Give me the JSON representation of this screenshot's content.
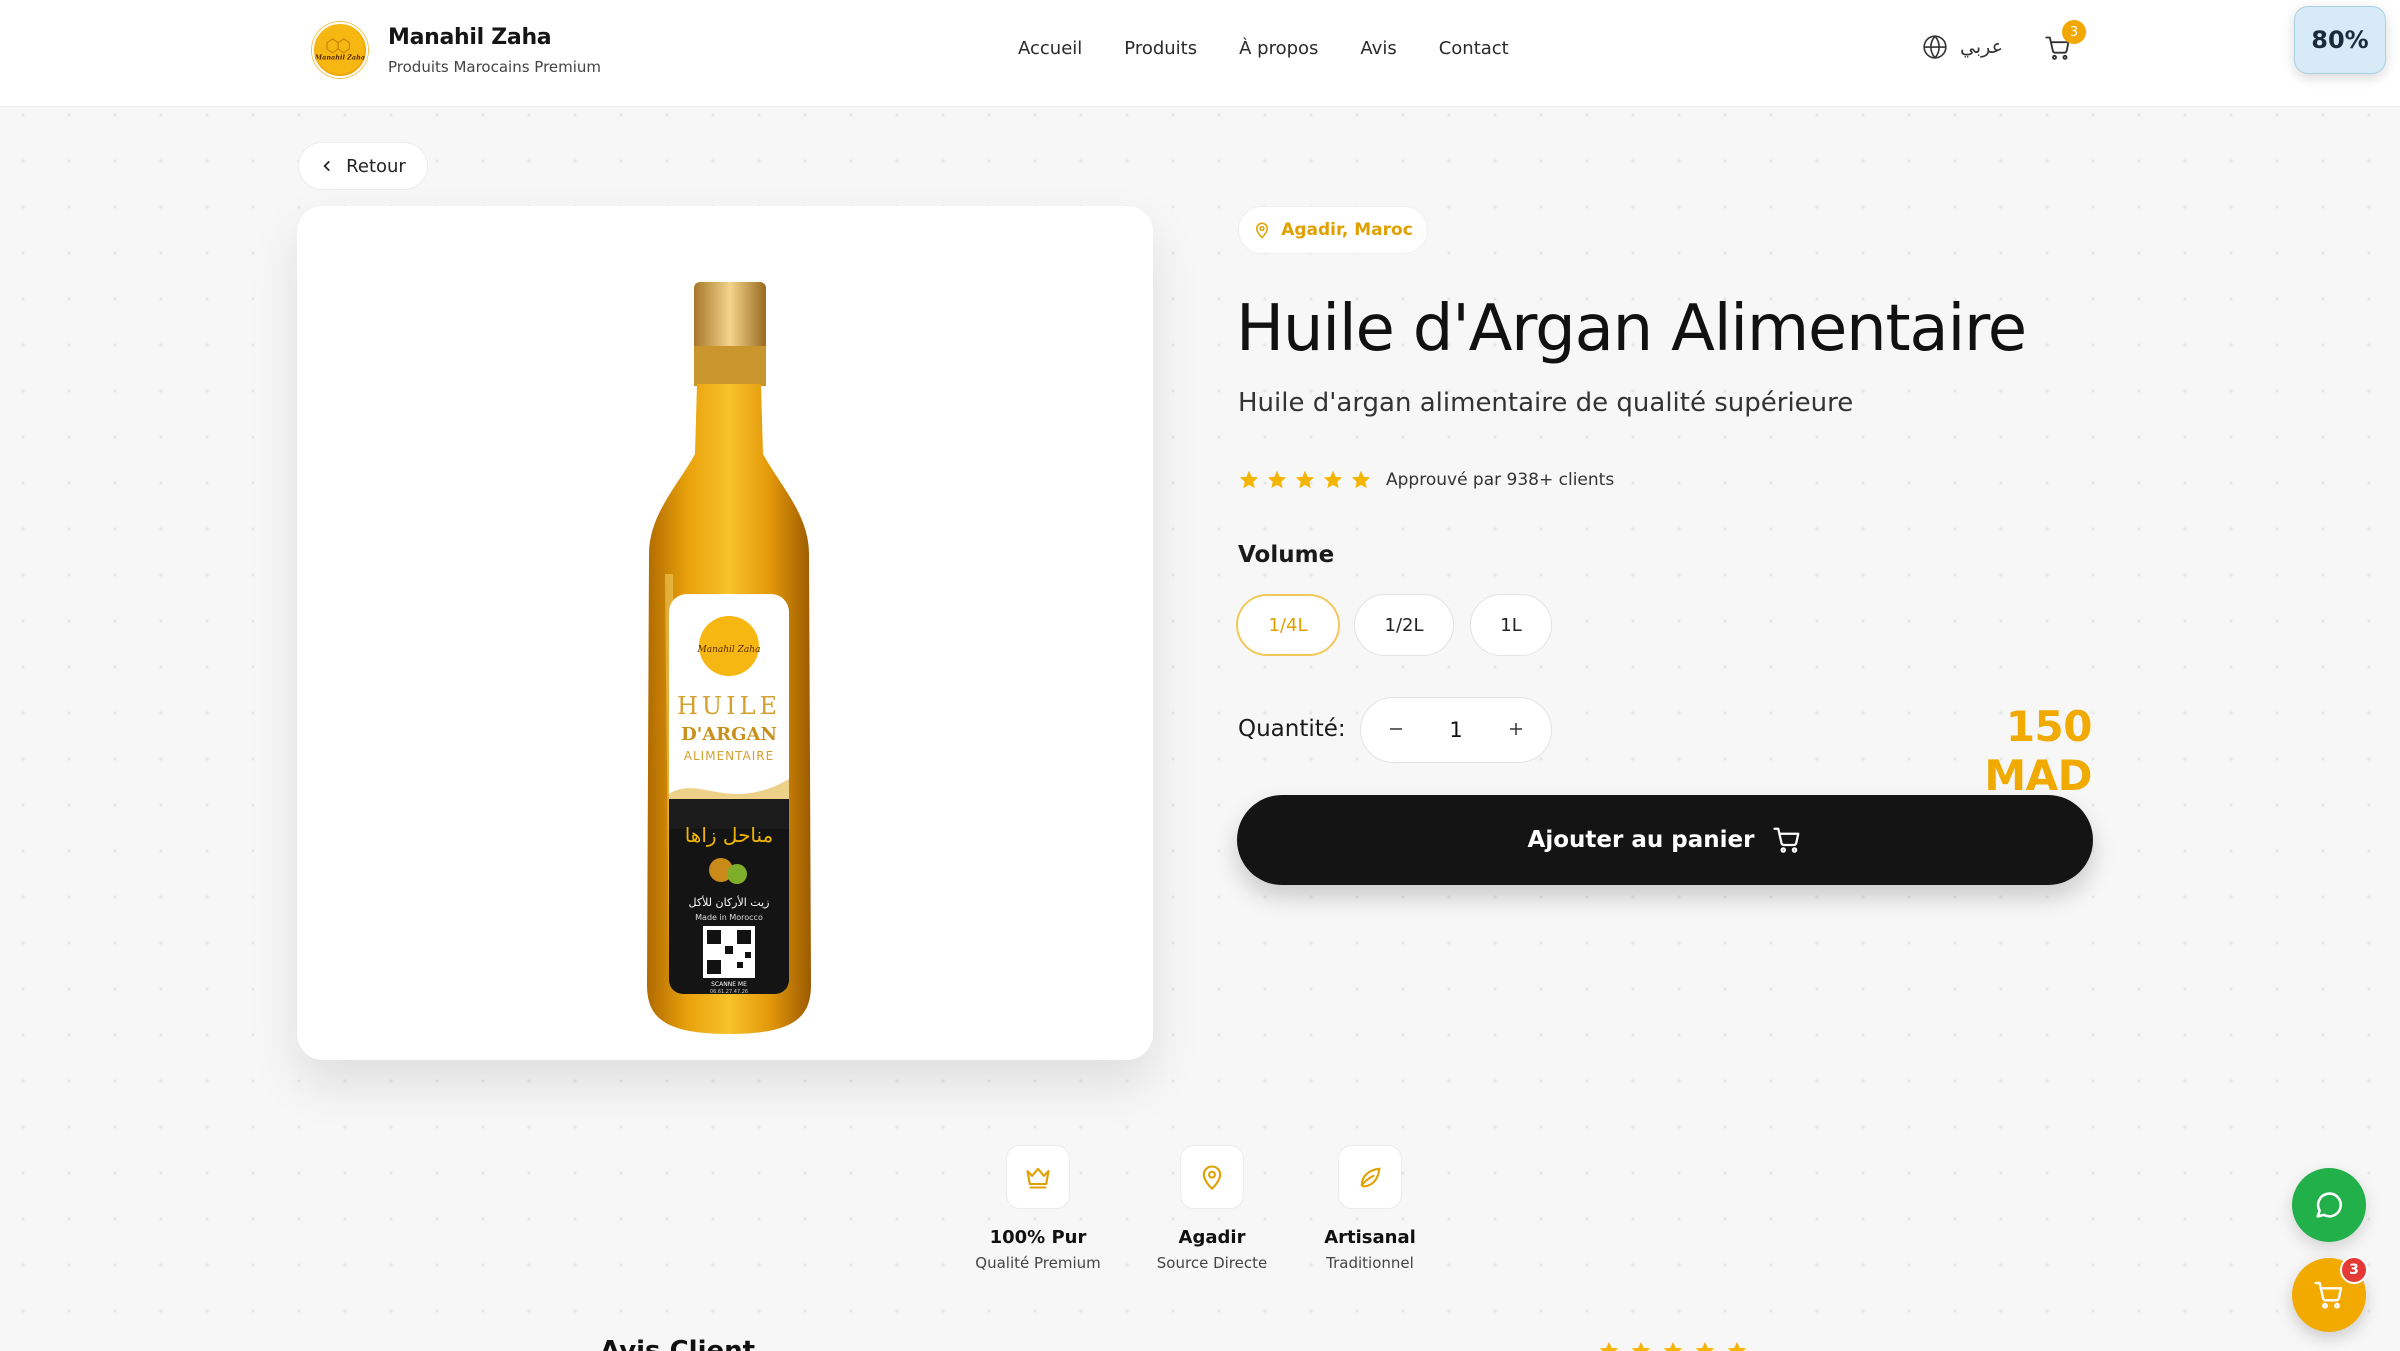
{
  "header": {
    "brand_name": "Manahil Zaha",
    "brand_subtitle": "Produits Marocains Premium",
    "logo_text": "Manahil Zaha",
    "nav": [
      "Accueil",
      "Produits",
      "À propos",
      "Avis",
      "Contact"
    ],
    "language_label": "عربي",
    "cart_count": "3"
  },
  "browser": {
    "zoom": "80%"
  },
  "back_label": "Retour",
  "product": {
    "location": "Agadir, Maroc",
    "title": "Huile d'Argan Alimentaire",
    "subtitle": "Huile d'argan alimentaire de qualité supérieure",
    "rating_stars": 5,
    "approved_text": "Approuvé par 938+ clients",
    "volume_label": "Volume",
    "volumes": [
      "1/4L",
      "1/2L",
      "1L"
    ],
    "selected_volume": "1/4L",
    "quantity_label": "Quantité:",
    "quantity": "1",
    "price": "150 MAD",
    "add_to_cart": "Ajouter au panier"
  },
  "label_art": {
    "line1": "HUILE",
    "line2": "D'ARGAN",
    "line3": "ALIMENTAIRE",
    "arabic_brand": "مناحل زاها",
    "arabic_product": "زيت الأركان للأكل",
    "made_in": "Made in Morocco",
    "scan": "SCANNE ME",
    "phone": "06.61.27.47.26"
  },
  "features": [
    {
      "icon": "crown-icon",
      "title": "100% Pur",
      "subtitle": "Qualité Premium"
    },
    {
      "icon": "map-pin-icon",
      "title": "Agadir",
      "subtitle": "Source Directe"
    },
    {
      "icon": "leaf-icon",
      "title": "Artisanal",
      "subtitle": "Traditionnel"
    }
  ],
  "reviews_heading_partial": "Avis Client",
  "floating": {
    "cart_count": "3"
  },
  "colors": {
    "accent": "#f0aa00",
    "dark": "#141414",
    "whatsapp": "#22b04b",
    "badge_red": "#e53935"
  }
}
